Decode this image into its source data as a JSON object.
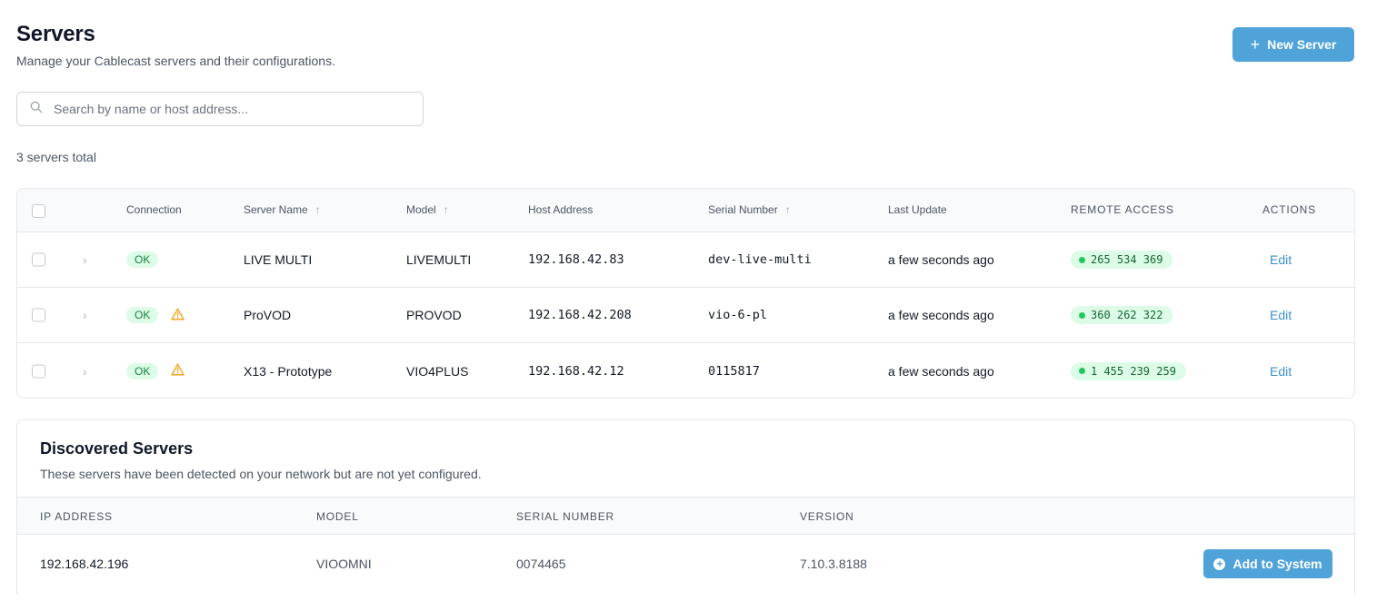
{
  "header": {
    "title": "Servers",
    "subtitle": "Manage your Cablecast servers and their configurations.",
    "new_server_label": "New Server"
  },
  "search": {
    "placeholder": "Search by name or host address...",
    "value": ""
  },
  "summary": {
    "total_text": "3 servers total"
  },
  "table": {
    "columns": {
      "connection": "Connection",
      "server_name": "Server Name",
      "model": "Model",
      "host_address": "Host Address",
      "serial_number": "Serial Number",
      "last_update": "Last Update",
      "remote_access": "REMOTE ACCESS",
      "actions": "ACTIONS"
    },
    "rows": [
      {
        "connection": "OK",
        "warning": false,
        "name": "LIVE MULTI",
        "model": "LIVEMULTI",
        "host": "192.168.42.83",
        "serial": "dev-live-multi",
        "last_update": "a few seconds ago",
        "remote_access": "265 534 369",
        "action": "Edit"
      },
      {
        "connection": "OK",
        "warning": true,
        "name": "ProVOD",
        "model": "PROVOD",
        "host": "192.168.42.208",
        "serial": "vio-6-pl",
        "last_update": "a few seconds ago",
        "remote_access": "360 262 322",
        "action": "Edit"
      },
      {
        "connection": "OK",
        "warning": true,
        "name": "X13 - Prototype",
        "model": "VIO4PLUS",
        "host": "192.168.42.12",
        "serial": "0115817",
        "last_update": "a few seconds ago",
        "remote_access": "1 455 239 259",
        "action": "Edit"
      }
    ]
  },
  "discovered": {
    "title": "Discovered Servers",
    "subtitle": "These servers have been detected on your network but are not yet configured.",
    "columns": {
      "ip": "IP ADDRESS",
      "model": "MODEL",
      "serial": "SERIAL NUMBER",
      "version": "VERSION"
    },
    "rows": [
      {
        "ip": "192.168.42.196",
        "model": "VIOOMNI",
        "serial": "0074465",
        "version": "7.10.3.8188",
        "action": "Add to System"
      }
    ]
  },
  "icons": {
    "new_server": "plus-icon",
    "search": "search-icon",
    "sort": "arrow-up-icon",
    "expand": "chevron-right-icon",
    "warning": "warning-triangle-icon",
    "remote_status": "status-dot-icon",
    "add": "plus-circle-icon"
  },
  "colors": {
    "primary": "#4fa3d9",
    "ok_bg": "#dcfce7",
    "ok_text": "#15803d",
    "warning": "#f59e0b",
    "link": "#3b8fcc"
  }
}
